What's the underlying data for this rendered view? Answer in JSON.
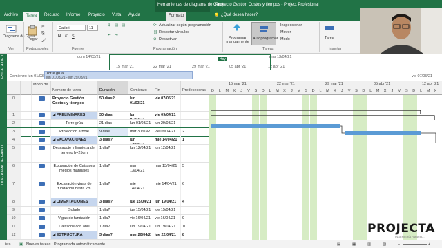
{
  "titlebar": {
    "context_tools": "Herramientas de diagrama de Gantt",
    "doc_title": "Proyecto Gestión Costos y tiempos - Project Profesional"
  },
  "tabs": [
    "Archivo",
    "Tarea",
    "Recurso",
    "Informe",
    "Proyecto",
    "Vista",
    "Ayuda",
    "Formato"
  ],
  "tell_me": "¿Qué desea hacer?",
  "ribbon": {
    "gantt_btn": "Diagrama de Gantt",
    "group_ver": "Ver",
    "paste": "Pegar",
    "group_clip": "Portapapeles",
    "font_name": "Calibri",
    "font_size": "11",
    "group_font": "Fuente",
    "update": "Actualizar según programación",
    "respect": "Respetar vínculos",
    "deactivate": "Desactivar",
    "group_sched": "Programación",
    "manual": "Programar manualmente",
    "auto": "Autoprogramar",
    "inspect": "Inspeccionar",
    "move": "Mover",
    "mode": "Modo",
    "group_tasks": "Tareas",
    "task": "Tarea",
    "group_insert": "Insertar"
  },
  "timeline": {
    "side": "ESCALA DE T.",
    "start": "Comienzo lun 01/03/21",
    "today": "Hoy",
    "dates": [
      "dom 14/03/21",
      "15 mar '21",
      "22 mar '21",
      "29 mar '21",
      "05 abr '21",
      "12 abr '21",
      "mar 13/04/21",
      "vie 07/05/21"
    ],
    "bar_label": "Torre grúa",
    "bar_dates": "lun 01/03/21 - lun 29/03/21"
  },
  "gantt_side": "DIAGRAMA DE GANTT",
  "columns": {
    "info": "i",
    "mode": "Modo de",
    "name": "Nombre de tarea",
    "duration": "Duración",
    "start": "Comienzo",
    "finish": "Fin",
    "pred": "Predecesoras"
  },
  "rows": [
    {
      "id": "0",
      "name": "Proyecto Gestión Costos y tiempos",
      "dur": "50 días?",
      "start": "lun 01/03/21",
      "finish": "vie 07/05/21",
      "pred": ""
    },
    {
      "id": "1",
      "name": "◢ PRELIMINARES",
      "dur": "30 días",
      "start": "lun 01/03/21",
      "finish": "vie 09/04/21",
      "pred": ""
    },
    {
      "id": "2",
      "name": "Torre grúa",
      "dur": "21 días",
      "start": "lun 01/03/21",
      "finish": "lun 29/03/21",
      "pred": ""
    },
    {
      "id": "3",
      "name": "Protección arbole",
      "dur": "9 días",
      "start": "mar 30/03/2",
      "finish": "vie 09/04/21",
      "pred": "2"
    },
    {
      "id": "4",
      "name": "◢ EXCAVACIONES",
      "dur": "3 días?",
      "start": "lun 12/04/21",
      "finish": "mié 14/04/21",
      "pred": "1"
    },
    {
      "id": "5",
      "name": "Descapote y limpieza del terreno h=25cm",
      "dur": "1 día?",
      "start": "lun 12/04/21",
      "finish": "lun 12/04/21",
      "pred": ""
    },
    {
      "id": "6",
      "name": "Excavación de Caissons medios manuales",
      "dur": "1 día?",
      "start": "mar 13/04/21",
      "finish": "mar 13/04/21",
      "pred": "5"
    },
    {
      "id": "7",
      "name": "Excavación vigas de fundación hasta 2m",
      "dur": "1 día?",
      "start": "mié 14/04/21",
      "finish": "mié 14/04/21",
      "pred": "6"
    },
    {
      "id": "8",
      "name": "◢ CIMENTACIONES",
      "dur": "3 días?",
      "start": "jue 15/04/21",
      "finish": "lun 19/04/21",
      "pred": "4"
    },
    {
      "id": "9",
      "name": "Solado",
      "dur": "1 día?",
      "start": "jue 15/04/21",
      "finish": "jue 15/04/21",
      "pred": ""
    },
    {
      "id": "10",
      "name": "Vigas de fundación",
      "dur": "1 día?",
      "start": "vie 16/04/21",
      "finish": "vie 16/04/21",
      "pred": "9"
    },
    {
      "id": "11",
      "name": "Caissons con anill",
      "dur": "1 día?",
      "start": "lun 19/04/21",
      "finish": "lun 19/04/21",
      "pred": "10"
    },
    {
      "id": "12",
      "name": "◢ ESTRUCTURA",
      "dur": "3 días?",
      "start": "mar 20/04/2",
      "finish": "jue 22/04/21",
      "pred": "8"
    },
    {
      "id": "13",
      "name": "Losa Maciza",
      "dur": "1 día?",
      "start": "mar 20/04/2",
      "finish": "mar 20/04/2",
      "pred": ""
    }
  ],
  "chart_header": {
    "weeks": [
      "15 mar '21",
      "22 mar '21",
      "29 mar '21",
      "05 abr '21",
      "12 abr '21"
    ],
    "days": [
      "D",
      "L",
      "M",
      "X",
      "J",
      "V",
      "S",
      "D",
      "L",
      "M",
      "X",
      "J",
      "V",
      "S",
      "D",
      "L",
      "M",
      "X",
      "J",
      "V",
      "S",
      "D",
      "L",
      "M",
      "X",
      "J",
      "V",
      "S",
      "D",
      "L",
      "M",
      "X"
    ]
  },
  "status": {
    "ready": "Lista",
    "new_tasks": "Nuevas tareas : Programada automáticamente"
  },
  "logo": {
    "text": "PROJECTA",
    "sub": "INGENIERÍA PARA EL..."
  }
}
